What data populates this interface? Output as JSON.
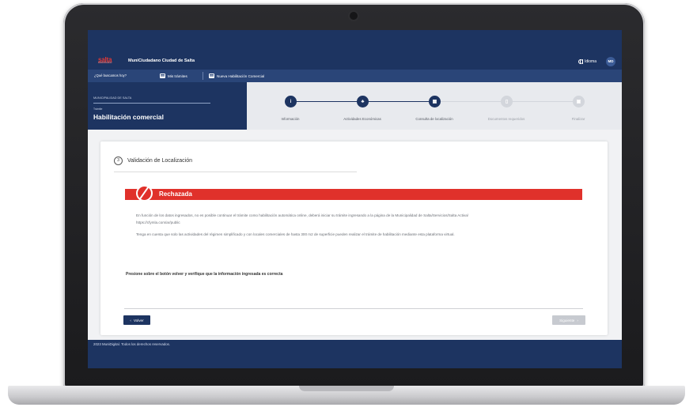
{
  "header": {
    "logo": "salta",
    "logo_sub": "MUNICIPALIDAD",
    "app_title": "MuniCiudadano Ciudad de Salta",
    "language_label": "Idioma",
    "user_initials": "MD"
  },
  "nav": {
    "help": "¿Qué buscamos hoy?",
    "my_procedures": "Mis trámites",
    "new_procedure": "Nueva Habilitación Comercial"
  },
  "procedure": {
    "organization": "MUNICIPALIDAD DE SALTA",
    "type_label": "Trámite",
    "title": "Habilitación comercial"
  },
  "steps": [
    {
      "label": "Información",
      "glyph": "i",
      "state": "done"
    },
    {
      "label": "Actividades Económicas",
      "glyph": "♣",
      "state": "done"
    },
    {
      "label": "Consulta de localización",
      "glyph": "▦",
      "state": "done"
    },
    {
      "label": "Documentos requeridos",
      "glyph": "▯",
      "state": "pending"
    },
    {
      "label": "Finalizar",
      "glyph": "▣",
      "state": "pending"
    }
  ],
  "section": {
    "number": "3",
    "title": "Validación de Localización"
  },
  "status": {
    "label": "Rechazada",
    "color": "#e0312b"
  },
  "messages": {
    "line1": "En función de los datos ingresados, no es posible continuar el trámite como habilitación automática online, deberá iniciar su trámite ingresando a la página de la Municipalidad de Salta/Servicios/Salta Activa/",
    "line2": "https://cfymla.com/ar/public",
    "line3": "Tenga en cuenta que solo las actividades del régimen simplificado y con locales comerciales de hasta 300 m2 de superficie pueden realizar el trámite de habilitación mediante esta plataforma virtual."
  },
  "instruction": "Presione sobre el botón volver y verifique que la información ingresada es correcta",
  "buttons": {
    "back": "Volver",
    "next": "Siguiente"
  },
  "footer": {
    "copyright": "2023 MuniDigital. Todos los derechos reservados."
  },
  "colors": {
    "primary": "#1d3461",
    "danger": "#e0312b",
    "disabled": "#c7cad0"
  }
}
